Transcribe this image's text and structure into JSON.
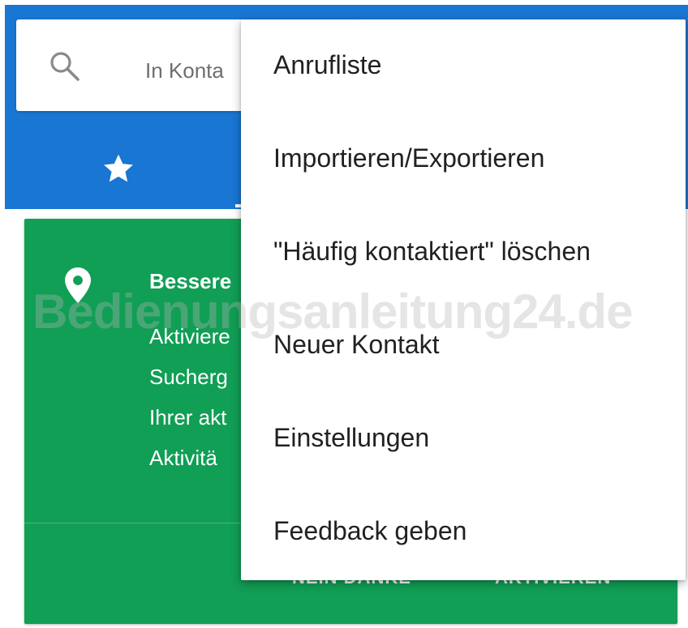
{
  "search": {
    "placeholder_visible": "In Konta",
    "icon": "search-icon"
  },
  "tabs": [
    {
      "icon": "star-icon",
      "label": ""
    }
  ],
  "promo_card": {
    "icon": "location-pin-icon",
    "title_visible": "Bessere",
    "lines_visible": [
      "Aktiviere",
      "Sucherg",
      "Ihrer akt",
      "Aktivitä"
    ],
    "dismiss_label_visible": "NEIN DANKE",
    "activate_label_visible": "AKTIVIEREN",
    "color": "#119e55"
  },
  "menu": {
    "items": [
      {
        "label": "Anrufliste"
      },
      {
        "label": "Importieren/Exportieren"
      },
      {
        "label": "\"Häufig kontaktiert\" löschen"
      },
      {
        "label": "Neuer Kontakt"
      },
      {
        "label": "Einstellungen"
      },
      {
        "label": "Feedback geben"
      }
    ]
  },
  "watermark": "Bedienungsanleitung24.de",
  "colors": {
    "appbar": "#1976d2",
    "card": "#119e55",
    "menu_bg": "#ffffff",
    "menu_text": "#212121"
  }
}
